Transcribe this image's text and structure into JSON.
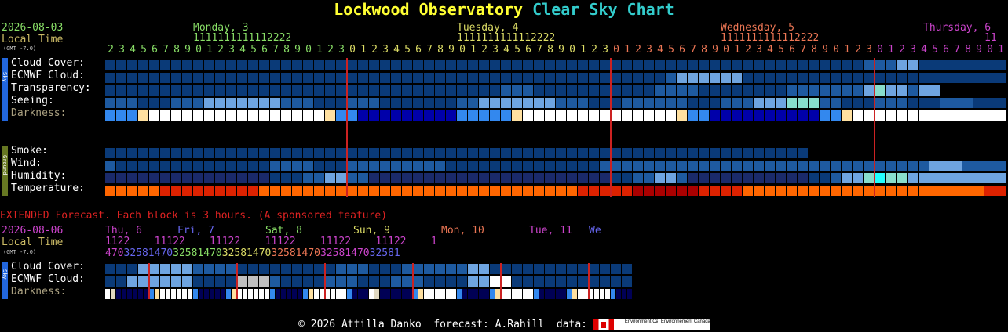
{
  "title": {
    "part1": "Lockwood Observatory",
    "part2": "Clear Sky Chart"
  },
  "header": {
    "date": "2026-08-03",
    "local_time": "Local Time",
    "gmt": "(GMT -7.0)",
    "days": [
      {
        "label": "Monday, 3",
        "color": "#88dd66"
      },
      {
        "label": "Tuesday, 4",
        "color": "#dddd66"
      },
      {
        "label": "Wednesday, 5",
        "color": "#ee7755"
      },
      {
        "label": "Thursday, 6",
        "color": "#cc44cc"
      }
    ],
    "tens_rows": [
      "1111111111112222",
      "1111111111112222",
      "1111111111112222",
      "11"
    ],
    "hours_digits": "2345678901234567890123012345678901234567890123012345678901234567890123012345678901"
  },
  "sections": {
    "sky_label": "Sky",
    "ground_label": "Ground",
    "rows": [
      {
        "label": "Cloud Cover:"
      },
      {
        "label": "ECMWF Cloud:"
      },
      {
        "label": "Transparency:"
      },
      {
        "label": "Seeing:"
      },
      {
        "label": "Darkness:"
      },
      {
        "label": "Smoke:"
      },
      {
        "label": "Wind:"
      },
      {
        "label": "Humidity:"
      },
      {
        "label": "Temperature:"
      }
    ]
  },
  "extended": {
    "banner": "EXTENDED Forecast. Each block is 3 hours. (A sponsored feature)",
    "date": "2026-08-06",
    "local_time": "Local Time",
    "gmt": "(GMT -7.0)",
    "days": [
      {
        "label": "Thu, 6",
        "color": "#cc44cc"
      },
      {
        "label": "Fri, 7",
        "color": "#6666ee"
      },
      {
        "label": "Sat, 8",
        "color": "#88dd66"
      },
      {
        "label": "Sun, 9",
        "color": "#dddd66"
      },
      {
        "label": "Mon, 10",
        "color": "#ee7755"
      },
      {
        "label": "Tue, 11",
        "color": "#cc44cc"
      },
      {
        "label": "We",
        "color": "#6666ee"
      }
    ],
    "tens": "1122    11122    11122    11122    11122    11122    1",
    "hours": "47032581470325814703258147032581470325814703258147032581",
    "rows": [
      {
        "label": "Cloud Cover:"
      },
      {
        "label": "ECMWF Cloud:"
      },
      {
        "label": "Darkness:"
      }
    ]
  },
  "footer": {
    "text": "© 2026 Attilla Danko  forecast: A.Rahill  data:",
    "logo1": "Environment Canada",
    "logo2": "Environnement Canada"
  },
  "colors": {
    "sky_dark": "#0a3a78",
    "sky_mid": "#1e5aa0",
    "sky_light": "#6ea4e0",
    "sky_pale": "#a8c8f0",
    "white": "#ffffff",
    "gray": "#c0c0c0",
    "red_line": "#cc2222",
    "temp_orange": "#ff6600",
    "temp_red": "#dd2200"
  }
}
